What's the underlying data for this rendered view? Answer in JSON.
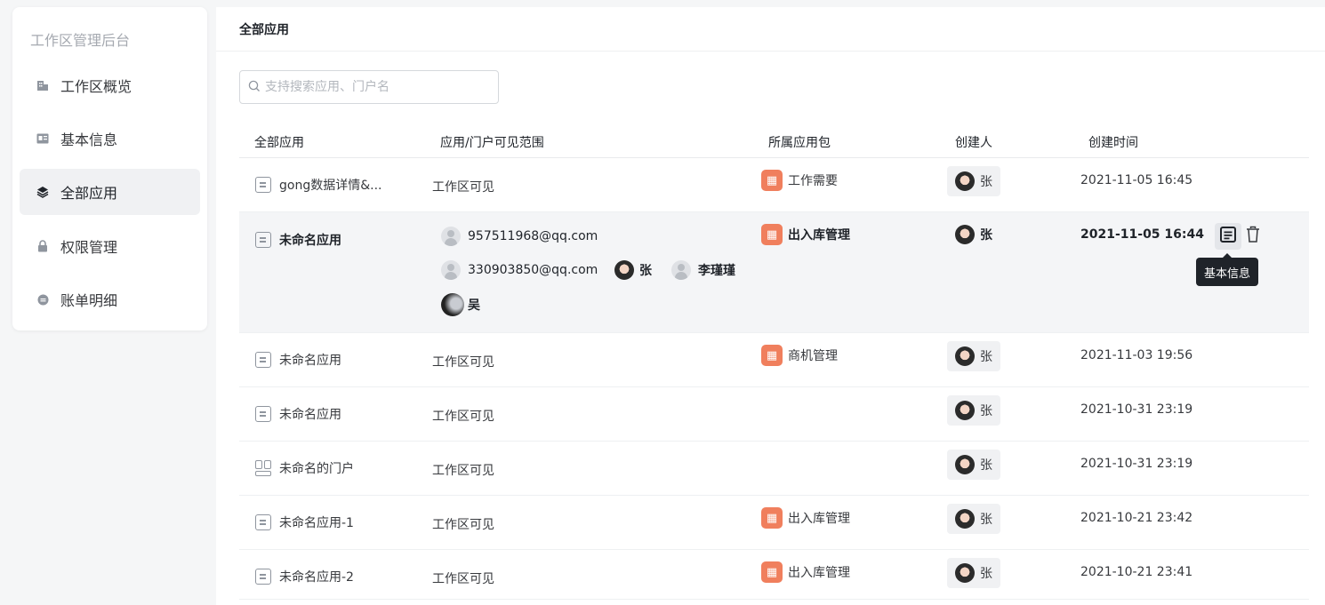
{
  "sidebar": {
    "title": "工作区管理后台",
    "items": [
      {
        "label": "工作区概览",
        "icon": "building-icon"
      },
      {
        "label": "基本信息",
        "icon": "id-card-icon"
      },
      {
        "label": "全部应用",
        "icon": "layers-icon",
        "active": true
      },
      {
        "label": "权限管理",
        "icon": "lock-icon"
      },
      {
        "label": "账单明细",
        "icon": "coin-icon"
      }
    ]
  },
  "main": {
    "title": "全部应用",
    "search": {
      "placeholder": "支持搜索应用、门户名",
      "value": ""
    },
    "columns": [
      "全部应用",
      "应用/门户可见范围",
      "所属应用包",
      "创建人",
      "创建时间"
    ],
    "rows": [
      {
        "name": "gong数据详情&...",
        "scope": "工作区可见",
        "package": "工作需要",
        "creator": "张",
        "time": "2021-11-05 16:45"
      },
      {
        "name": "未命名应用",
        "members": [
          {
            "name": "957511968@qq.com",
            "avatar": "default"
          },
          {
            "name": "330903850@qq.com",
            "avatar": "default"
          },
          {
            "name": "张",
            "avatar": "photo"
          },
          {
            "name": "李瑾瑾",
            "avatar": "default"
          },
          {
            "name": "吴",
            "avatar": "dark"
          }
        ],
        "package": "出入库管理",
        "creator": "张",
        "time": "2021-11-05 16:44"
      },
      {
        "name": "未命名应用",
        "scope": "工作区可见",
        "package": "商机管理",
        "creator": "张",
        "time": "2021-11-03 19:56"
      },
      {
        "name": "未命名应用",
        "scope": "工作区可见",
        "package": "",
        "creator": "张",
        "time": "2021-10-31 23:19"
      },
      {
        "name": "未命名的门户",
        "scope": "工作区可见",
        "package": "",
        "creator": "张",
        "time": "2021-10-31 23:19",
        "type": "portal"
      },
      {
        "name": "未命名应用-1",
        "scope": "工作区可见",
        "package": "出入库管理",
        "creator": "张",
        "time": "2021-10-21 23:42"
      },
      {
        "name": "未命名应用-2",
        "scope": "工作区可见",
        "package": "出入库管理",
        "creator": "张",
        "time": "2021-10-21 23:41"
      }
    ],
    "tooltip": "基本信息"
  },
  "colors": {
    "accent_package": "#f07f5d",
    "hover_row": "#f4f5f7",
    "active_nav": "#f0f1f3"
  }
}
